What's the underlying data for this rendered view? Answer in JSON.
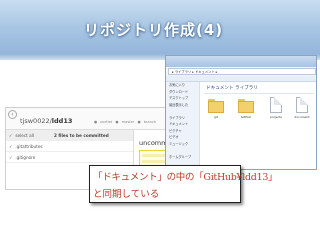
{
  "slide": {
    "title": "リポジトリ作成(4)"
  },
  "github_app": {
    "back_icon": "‹",
    "repo_owner": "tjsw0022/",
    "repo_name": "ldd13",
    "tabs": "● portlet ● master ● branch",
    "rows": [
      {
        "check": "✓",
        "label": "select all",
        "count": "2 files to be committed"
      },
      {
        "check": "✓",
        "label": ".gitattributes",
        "count": ""
      },
      {
        "check": "✓",
        "label": ".gitignore",
        "count": ""
      }
    ],
    "uncommitted_label": "uncommitte",
    "history_label": "history"
  },
  "explorer": {
    "address": "▸ ライブラリ ▸ ドキュメント ▸",
    "sidebar_items": [
      "お気に入り",
      "ダウンロード",
      "デスクトップ",
      "最近表示した",
      "",
      "ライブラリ",
      "ドキュメント",
      "ピクチャ",
      "ビデオ",
      "ミュージック",
      "",
      "ホームグループ",
      "",
      "コンピューター",
      "ローカル ディスク",
      "",
      "ネットワーク"
    ],
    "library_title": "ドキュメント ライブラリ",
    "files": [
      "git",
      "GitHub",
      "projects",
      "document"
    ]
  },
  "caption": {
    "line1": "「ドキュメント」の中の「GitHub¥ldd13」",
    "line2": "と同期している"
  },
  "colors": {
    "header_top": "#c9ddf0",
    "header_bottom": "#8fb2d8",
    "caption_text": "#c0392b"
  }
}
